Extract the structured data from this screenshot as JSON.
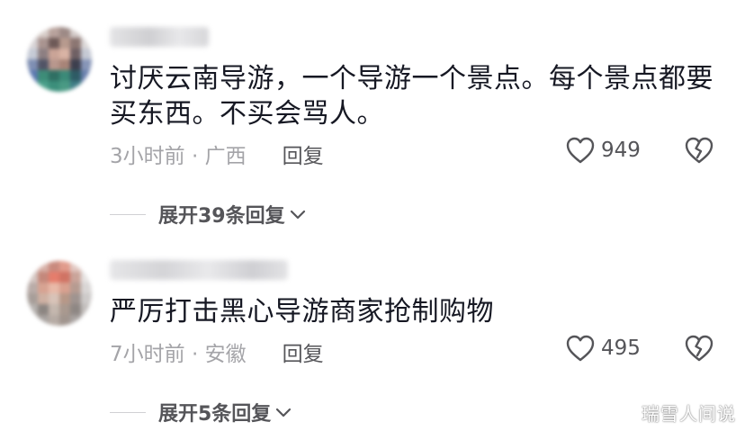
{
  "comments": [
    {
      "text": "讨厌云南导游，一个导游一个景点。每个景点都要买东西。不买会骂人。",
      "time_location": "3小时前 · 广西",
      "reply_label": "回复",
      "likes": "949",
      "expand_label": "展开39条回复"
    },
    {
      "text": "严厉打击黑心导游商家抢制购物",
      "time_location": "7小时前 · 安徽",
      "reply_label": "回复",
      "likes": "495",
      "expand_label": "展开5条回复"
    }
  ],
  "watermark": "瑞雪人间说",
  "icons": {
    "like": "heart-outline-icon",
    "dislike": "broken-heart-icon",
    "expand": "chevron-down-icon"
  },
  "colors": {
    "text": "#161823",
    "meta": "#a4a4a8",
    "action": "#555559"
  }
}
